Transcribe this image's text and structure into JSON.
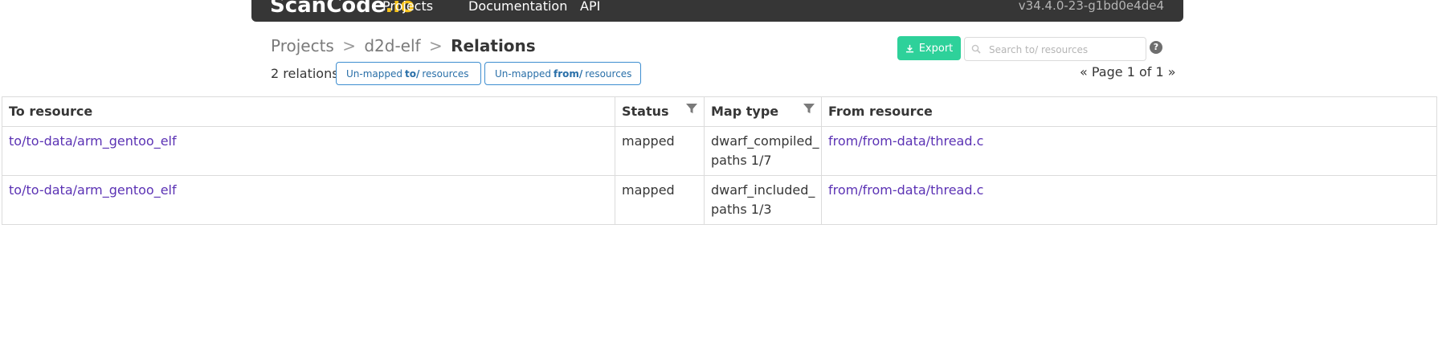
{
  "navbar": {
    "brand": "ScanCode",
    "brand_suffix": ".io",
    "links": [
      "Projects",
      "Documentation",
      "API"
    ],
    "version": "v34.4.0-23-g1bd0e4de4"
  },
  "breadcrumb": {
    "projects": "Projects",
    "separator": ">",
    "project": "d2d-elf",
    "current": "Relations"
  },
  "summary": {
    "count_text": "2 relations"
  },
  "unmapped_to": {
    "prefix": "Un-mapped",
    "bold": "to/",
    "suffix": "resources"
  },
  "unmapped_from": {
    "prefix": "Un-mapped",
    "bold": "from/",
    "suffix": "resources"
  },
  "toolbar": {
    "export_label": "Export",
    "search_placeholder": "Search to/ resources",
    "help_label": "?"
  },
  "pagination": {
    "text": "« Page 1 of 1 »"
  },
  "table": {
    "headers": [
      "To resource",
      "Status",
      "Map type",
      "From resource"
    ],
    "rows": [
      {
        "to_resource": "to/to-data/arm_gentoo_elf",
        "status": "mapped",
        "map_type_line1": "dwarf_compiled_",
        "map_type_line2": "paths 1/7",
        "from_resource": "from/from-data/thread.c"
      },
      {
        "to_resource": "to/to-data/arm_gentoo_elf",
        "status": "mapped",
        "map_type_line1": "dwarf_included_",
        "map_type_line2": "paths 1/3",
        "from_resource": "from/from-data/thread.c"
      }
    ]
  },
  "colors": {
    "navbar_bg": "#363636",
    "brand_accent": "#f5c21b",
    "export_bg": "#2ed19a",
    "link_button": "#3e8ed0",
    "table_link": "#5b32b4"
  },
  "icons": {
    "filter": "filter-icon",
    "download": "download-icon",
    "search": "search-icon",
    "external_link": "external-link-icon",
    "help": "question-circle-icon"
  }
}
